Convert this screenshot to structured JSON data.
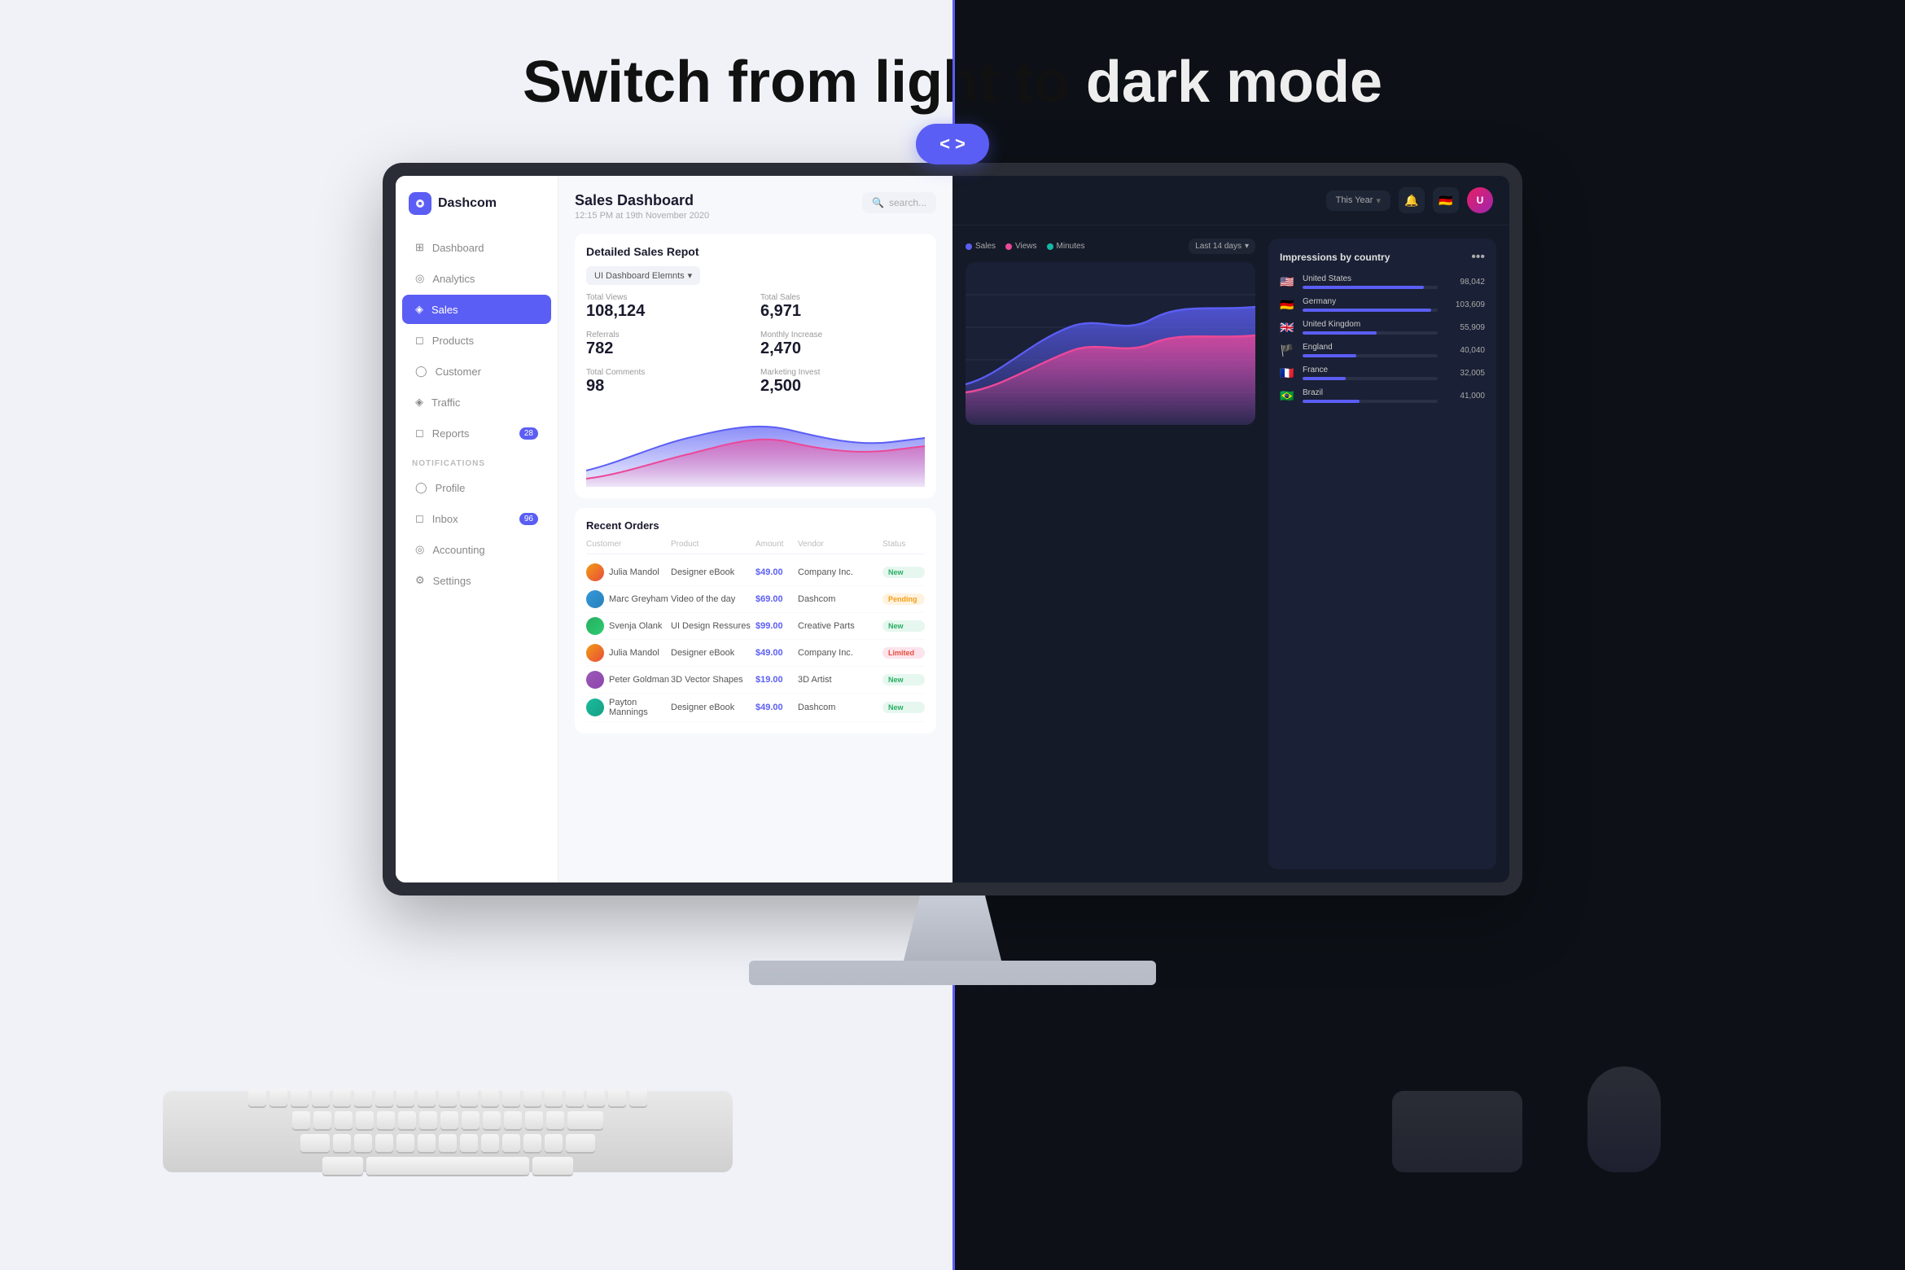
{
  "header": {
    "title_light": "Switch from light to",
    "title_dark": "dark mode"
  },
  "toggle": {
    "left_arrow": "<",
    "right_arrow": ">"
  },
  "dashboard_light": {
    "logo": "Dashcom",
    "page_title": "Sales Dashboard",
    "page_subtitle": "12:15 PM at 19th November 2020",
    "search_placeholder": "search...",
    "nav_items": [
      {
        "label": "Dashboard",
        "icon": "grid",
        "active": false
      },
      {
        "label": "Analytics",
        "icon": "chart",
        "active": false
      },
      {
        "label": "Sales",
        "icon": "tag",
        "active": true
      },
      {
        "label": "Products",
        "icon": "box",
        "active": false
      },
      {
        "label": "Customer",
        "icon": "user",
        "active": false
      },
      {
        "label": "Traffic",
        "icon": "traffic",
        "active": false
      },
      {
        "label": "Reports",
        "icon": "file",
        "active": false,
        "badge": "28"
      }
    ],
    "notifications_label": "NOTIFICATIONS",
    "nav_notifications": [
      {
        "label": "Profile",
        "icon": "user"
      },
      {
        "label": "Inbox",
        "icon": "inbox",
        "badge": "96"
      },
      {
        "label": "Accounting",
        "icon": "accounting"
      },
      {
        "label": "Settings",
        "icon": "settings"
      }
    ],
    "report_section": "Detailed Sales Repot",
    "dropdown": "UI Dashboard Elemnts",
    "stats": [
      {
        "label": "Total Views",
        "value": "108,124"
      },
      {
        "label": "Total Sales",
        "value": "6,971"
      },
      {
        "label": "Referrals",
        "value": "782"
      },
      {
        "label": "Monthly Increase",
        "value": "2,470"
      },
      {
        "label": "Total Comments",
        "value": "98"
      },
      {
        "label": "Marketing Invest",
        "value": "2,500"
      }
    ],
    "orders_title": "Recent Orders",
    "table_headers": [
      "Customer",
      "Product",
      "Amount",
      "Vendor",
      "Status"
    ],
    "orders": [
      {
        "customer": "Julia Mandol",
        "product": "Designer eBook",
        "amount": "$49.00",
        "vendor": "Company Inc.",
        "status": "new"
      },
      {
        "customer": "Marc Greyham",
        "product": "Video of the day",
        "amount": "$69.00",
        "vendor": "Dashcom",
        "status": "pending"
      },
      {
        "customer": "Svenja Olank",
        "product": "UI Design Ressures",
        "amount": "$99.00",
        "vendor": "Creative Parts",
        "status": "new"
      },
      {
        "customer": "Julia Mandol",
        "product": "Designer eBook",
        "amount": "$49.00",
        "vendor": "Company Inc.",
        "status": "limited"
      },
      {
        "customer": "Peter Goldman",
        "product": "3D Vector Shapes",
        "amount": "$19.00",
        "vendor": "3D Artist",
        "status": "new"
      },
      {
        "customer": "Payton Mannings",
        "product": "Designer eBook",
        "amount": "$49.00",
        "vendor": "Dashcom",
        "status": "new"
      }
    ]
  },
  "dashboard_dark": {
    "header_btn": "This Year",
    "legend": [
      {
        "label": "Sales",
        "color": "#5b5ef4"
      },
      {
        "label": "Views",
        "color": "#ec4899"
      },
      {
        "label": "Minutes",
        "color": "#14b8a6"
      }
    ],
    "chart_period": "Last 14 days",
    "impressions_title": "Impressions by country",
    "countries": [
      {
        "name": "United States",
        "flag": "🇺🇸",
        "value": "98,042",
        "bar": 90,
        "color": "#5b5ef4"
      },
      {
        "name": "Germany",
        "flag": "🇩🇪",
        "value": "103,609",
        "bar": 95,
        "color": "#5b5ef4"
      },
      {
        "name": "United Kingdom",
        "flag": "🇬🇧",
        "value": "55,909",
        "bar": 55,
        "color": "#5b5ef4"
      },
      {
        "name": "England",
        "flag": "🏴󠁧󠁢󠁥󠁮󠁧󠁿",
        "value": "40,040",
        "bar": 40,
        "color": "#5b5ef4"
      },
      {
        "name": "France",
        "flag": "🇫🇷",
        "value": "32,005",
        "bar": 32,
        "color": "#5b5ef4"
      },
      {
        "name": "Brazil",
        "flag": "🇧🇷",
        "value": "41,000",
        "bar": 42,
        "color": "#5b5ef4"
      }
    ]
  }
}
